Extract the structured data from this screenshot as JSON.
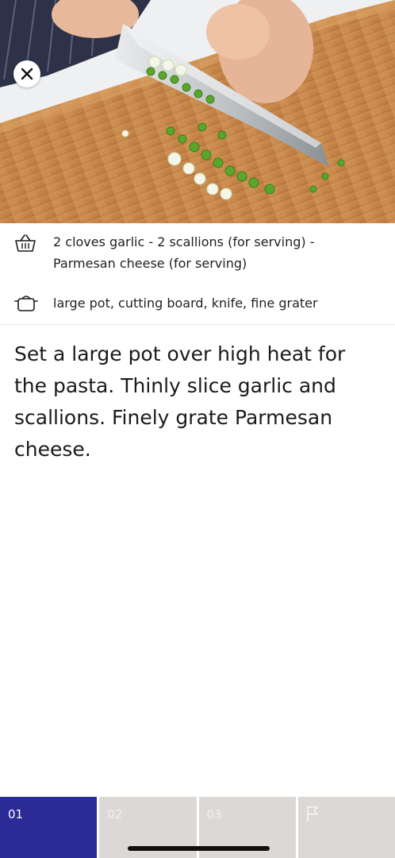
{
  "header": {
    "close_icon": "close-icon",
    "hero_image": "sliced-scallions-on-cutting-board"
  },
  "ingredients": {
    "icon": "basket-icon",
    "text": "2 cloves garlic - 2 scallions (for serving) - Parmesan cheese (for serving)"
  },
  "tools": {
    "icon": "pot-icon",
    "text": "large pot, cutting board, knife, fine grater"
  },
  "instructions": {
    "text": "Set a large pot over high heat for the pasta. Thinly slice garlic and scallions. Finely grate Parmesan cheese."
  },
  "steps": [
    {
      "label": "01",
      "active": true
    },
    {
      "label": "02",
      "active": false
    },
    {
      "label": "03",
      "active": false
    },
    {
      "label": "",
      "icon": "flag-icon",
      "active": false
    }
  ],
  "colors": {
    "active_step": "#2c2a96",
    "inactive_step": "#dcd8d5"
  }
}
